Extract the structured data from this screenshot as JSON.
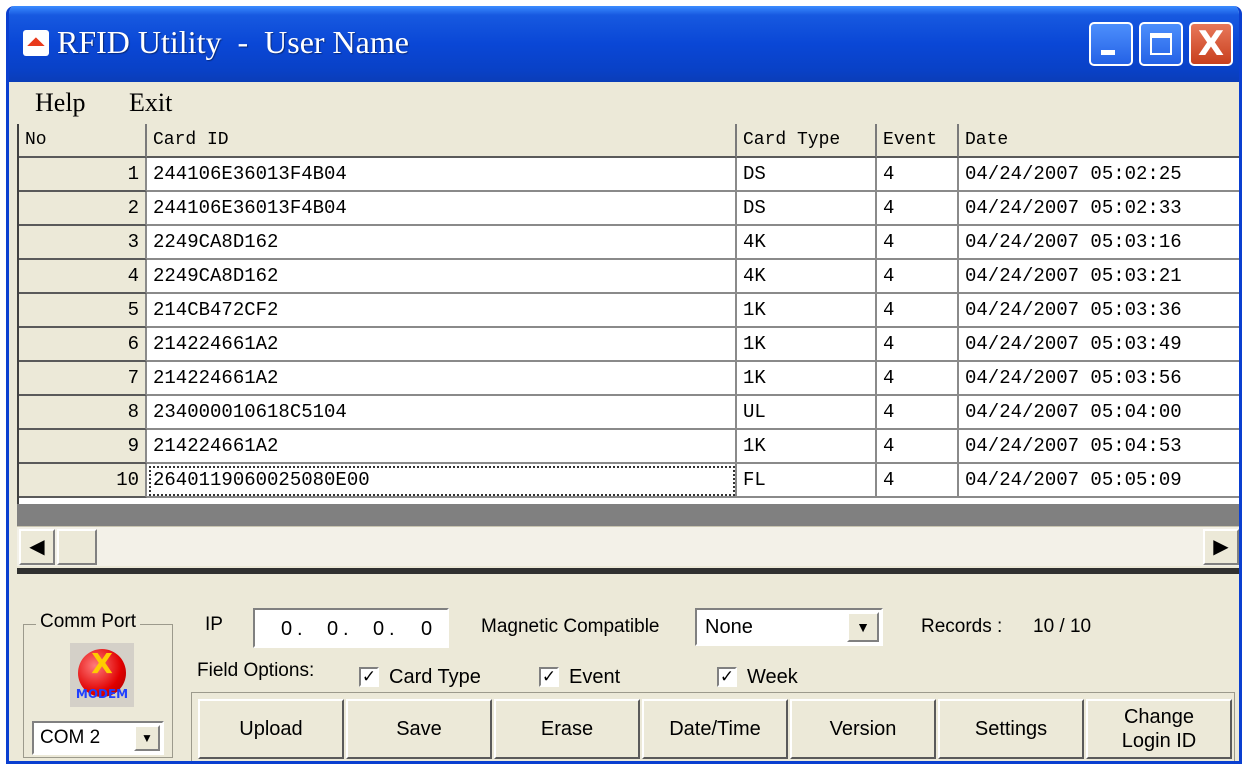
{
  "window": {
    "title": "RFID Utility  -  User Name",
    "minimize_label": "_",
    "close_label": "X"
  },
  "menu": {
    "help": "Help",
    "exit": "Exit"
  },
  "table": {
    "columns": [
      "No",
      "Card ID",
      "Card Type",
      "Event",
      "Date"
    ],
    "rows": [
      {
        "no": "1",
        "card_id": "244106E36013F4B04",
        "card_type": "DS",
        "event": "4",
        "date": "04/24/2007 05:02:25"
      },
      {
        "no": "2",
        "card_id": "244106E36013F4B04",
        "card_type": "DS",
        "event": "4",
        "date": "04/24/2007 05:02:33"
      },
      {
        "no": "3",
        "card_id": "2249CA8D162",
        "card_type": "4K",
        "event": "4",
        "date": "04/24/2007 05:03:16"
      },
      {
        "no": "4",
        "card_id": "2249CA8D162",
        "card_type": "4K",
        "event": "4",
        "date": "04/24/2007 05:03:21"
      },
      {
        "no": "5",
        "card_id": "214CB472CF2",
        "card_type": "1K",
        "event": "4",
        "date": "04/24/2007 05:03:36"
      },
      {
        "no": "6",
        "card_id": "214224661A2",
        "card_type": "1K",
        "event": "4",
        "date": "04/24/2007 05:03:49"
      },
      {
        "no": "7",
        "card_id": "214224661A2",
        "card_type": "1K",
        "event": "4",
        "date": "04/24/2007 05:03:56"
      },
      {
        "no": "8",
        "card_id": "234000010618C5104",
        "card_type": "UL",
        "event": "4",
        "date": "04/24/2007 05:04:00"
      },
      {
        "no": "9",
        "card_id": "214224661A2",
        "card_type": "1K",
        "event": "4",
        "date": "04/24/2007 05:04:53"
      },
      {
        "no": "10",
        "card_id": "2640119060025080E00",
        "card_type": "FL",
        "event": "4",
        "date": "04/24/2007 05:05:09"
      }
    ]
  },
  "scrollbar": {
    "left_arrow": "◀",
    "right_arrow": "▶"
  },
  "comm_port": {
    "label": "Comm Port",
    "modem_icon_text": "MODEM",
    "modem_icon_glyph": "X",
    "selected": "COM 2"
  },
  "ip": {
    "label": "IP",
    "octets": [
      "0",
      "0",
      "0",
      "0"
    ],
    "separator": "."
  },
  "magnetic": {
    "label": "Magnetic Compatible",
    "selected": "None"
  },
  "records": {
    "label": "Records :",
    "value": "10 / 10"
  },
  "field_options": {
    "label": "Field Options:",
    "check_glyph": "✓",
    "items": [
      {
        "label": "Card Type",
        "checked": true
      },
      {
        "label": "Event",
        "checked": true
      },
      {
        "label": "Week",
        "checked": true
      }
    ]
  },
  "buttons": {
    "upload": "Upload",
    "save": "Save",
    "erase": "Erase",
    "datetime": "Date/Time",
    "version": "Version",
    "settings": "Settings",
    "change_login_1": "Change",
    "change_login_2": "Login ID"
  },
  "dropdown_glyph": "▼"
}
